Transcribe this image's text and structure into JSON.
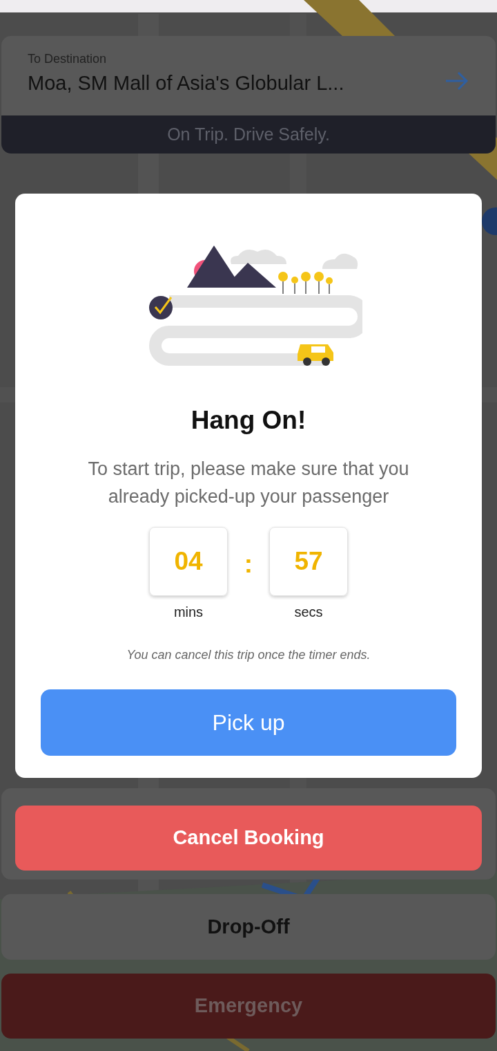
{
  "destination": {
    "label": "To Destination",
    "address": "Moa, SM Mall of Asia's Globular L..."
  },
  "status_banner": "On Trip. Drive Safely.",
  "dialog": {
    "title": "Hang On!",
    "message": "To start trip, please make sure that you already picked-up your passenger",
    "timer": [
      {
        "value": "04",
        "unit": "mins"
      },
      {
        "value": "57",
        "unit": "secs"
      }
    ],
    "separator": ":",
    "note": "You can cancel this trip once the timer ends.",
    "button": "Pick up"
  },
  "buttons": [
    {
      "label": "Cancel Booking",
      "kind": "cancel"
    },
    {
      "label": "Drop-Off",
      "kind": "neutral"
    },
    {
      "label": "Emergency",
      "kind": "emergency"
    }
  ]
}
